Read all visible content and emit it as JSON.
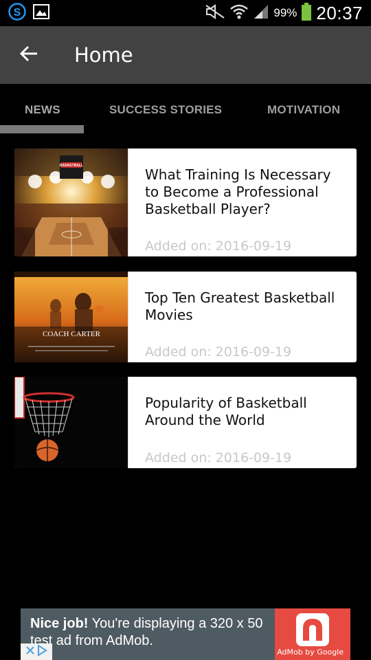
{
  "status_bar": {
    "battery_percent": "99%",
    "time": "20:37"
  },
  "app_bar": {
    "title": "Home"
  },
  "tabs": [
    {
      "label": "NEWS",
      "selected": true
    },
    {
      "label": "SUCCESS STORIES",
      "selected": false
    },
    {
      "label": "MOTIVATION",
      "selected": false
    }
  ],
  "articles": [
    {
      "title": "What Training Is Necessary to Become a Professional Basketball Player?",
      "date": "Added on: 2016-09-19",
      "thumbnail": "basketball-arena-image"
    },
    {
      "title": "Top Ten Greatest Basketball Movies",
      "date": "Added on: 2016-09-19",
      "thumbnail": "coach-carter-poster-image"
    },
    {
      "title": "Popularity of Basketball Around the World",
      "date": "Added on: 2016-09-19",
      "thumbnail": "basketball-hoop-image"
    }
  ],
  "thumb_texts": {
    "arena_sign": "BASKETBALL",
    "poster_title": "COACH CARTER"
  },
  "ad": {
    "bold": "Nice job!",
    "text": "You're displaying a 320 x 50 test ad from AdMob.",
    "brand": "AdMob by Google"
  },
  "colors": {
    "app_bar": "#424242",
    "background": "#000000",
    "tab_text": "#9e9e9e",
    "tab_indicator": "#7a7a7a",
    "battery": "#7cc242",
    "ad_background": "#4f5b62",
    "ad_accent": "#e64a41",
    "date_text": "#c8c8c8"
  }
}
